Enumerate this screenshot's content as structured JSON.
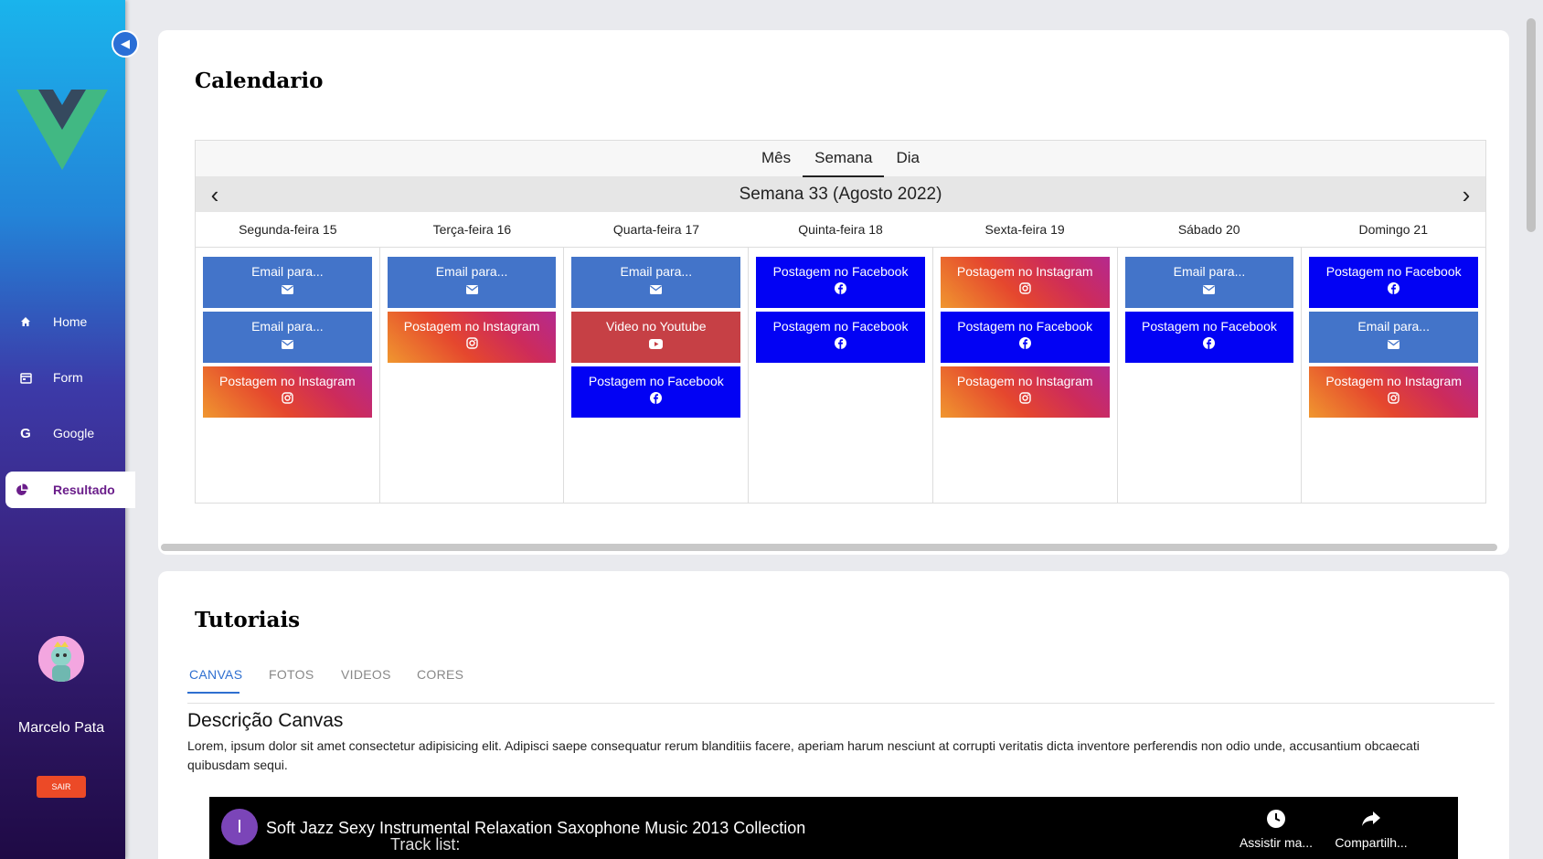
{
  "sidebar": {
    "collapse_icon": "◀",
    "items": [
      {
        "label": "Home",
        "icon": "home-icon"
      },
      {
        "label": "Form",
        "icon": "form-icon"
      },
      {
        "label": "Google",
        "icon": "google-icon"
      },
      {
        "label": "Resultado",
        "icon": "chart-pie-icon",
        "active": true
      }
    ],
    "user_name": "Marcelo Pata",
    "logout_label": "SAIR"
  },
  "calendar": {
    "title": "Calendario",
    "views": [
      "Mês",
      "Semana",
      "Dia"
    ],
    "active_view": "Semana",
    "week_title": "Semana 33 (Agosto 2022)",
    "days": [
      {
        "label": "Segunda-feira 15",
        "events": [
          {
            "label": "Email para...",
            "type": "email"
          },
          {
            "label": "Email para...",
            "type": "email"
          },
          {
            "label": "Postagem no Instagram",
            "type": "instagram"
          }
        ]
      },
      {
        "label": "Terça-feira 16",
        "events": [
          {
            "label": "Email para...",
            "type": "email"
          },
          {
            "label": "Postagem no Instagram",
            "type": "instagram"
          }
        ]
      },
      {
        "label": "Quarta-feira 17",
        "events": [
          {
            "label": "Email para...",
            "type": "email"
          },
          {
            "label": "Video no Youtube",
            "type": "youtube"
          },
          {
            "label": "Postagem no Facebook",
            "type": "facebook"
          }
        ]
      },
      {
        "label": "Quinta-feira 18",
        "events": [
          {
            "label": "Postagem no Facebook",
            "type": "facebook"
          },
          {
            "label": "Postagem no Facebook",
            "type": "facebook"
          }
        ]
      },
      {
        "label": "Sexta-feira 19",
        "events": [
          {
            "label": "Postagem no Instagram",
            "type": "instagram"
          },
          {
            "label": "Postagem no Facebook",
            "type": "facebook"
          },
          {
            "label": "Postagem no Instagram",
            "type": "instagram"
          }
        ]
      },
      {
        "label": "Sábado 20",
        "events": [
          {
            "label": "Email para...",
            "type": "email"
          },
          {
            "label": "Postagem no Facebook",
            "type": "facebook"
          }
        ]
      },
      {
        "label": "Domingo 21",
        "events": [
          {
            "label": "Postagem no Facebook",
            "type": "facebook"
          },
          {
            "label": "Email para...",
            "type": "email"
          },
          {
            "label": "Postagem no Instagram",
            "type": "instagram"
          }
        ]
      }
    ],
    "colors": {
      "email": "#4374c9",
      "facebook": "#0202f4",
      "youtube": "#c64045",
      "instagram": "#e5472e"
    }
  },
  "tutorials": {
    "title": "Tutoriais",
    "tabs": [
      "CANVAS",
      "FOTOS",
      "VIDEOS",
      "CORES"
    ],
    "active_tab": "CANVAS",
    "description_title": "Descrição Canvas",
    "description_text": "Lorem, ipsum dolor sit amet consectetur adipisicing elit. Adipisci saepe consequatur rerum blanditiis facere, aperiam harum nesciunt at corrupti veritatis dicta inventore perferendis non odio unde, accusantium obcaecati quibusdam sequi.",
    "video": {
      "channel_initial": "I",
      "title": "Soft Jazz Sexy Instrumental Relaxation Saxophone Music 2013 Collection",
      "overlay_text": "Track list:",
      "watch_later_label": "Assistir ma...",
      "share_label": "Compartilh..."
    }
  }
}
